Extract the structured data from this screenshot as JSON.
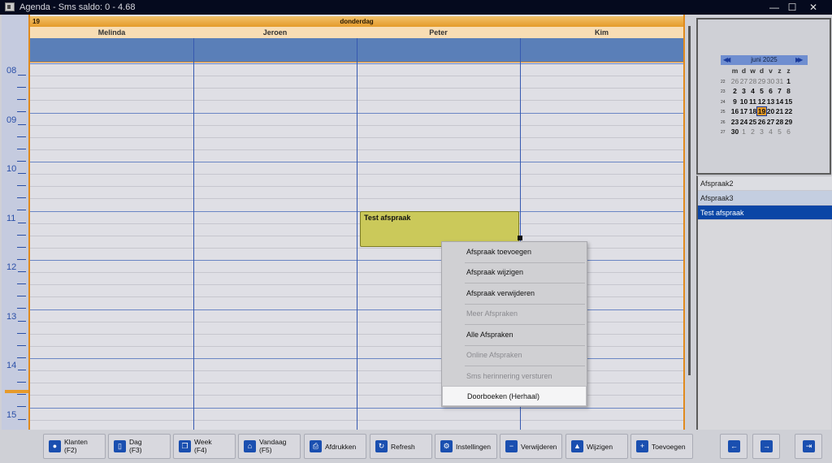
{
  "window": {
    "title": "Agenda - Sms saldo: 0 - 4.68",
    "minimize": "—",
    "maximize": "☐",
    "close": "✕"
  },
  "day": {
    "number": "19",
    "name": "donderdag"
  },
  "columns": [
    "Melinda",
    "Jeroen",
    "Peter",
    "Kim"
  ],
  "hours": [
    "08",
    "09",
    "10",
    "11",
    "12",
    "13",
    "14",
    "15"
  ],
  "appointment": {
    "title": "Test afspraak"
  },
  "context_menu": [
    {
      "label": "Afspraak toevoegen",
      "enabled": true
    },
    {
      "label": "Afspraak wijzigen",
      "enabled": true
    },
    {
      "label": "Afspraak verwijderen",
      "enabled": true
    },
    {
      "label": "Meer Afspraken",
      "enabled": false
    },
    {
      "label": "Alle Afspraken",
      "enabled": true
    },
    {
      "label": "Online Afspraken",
      "enabled": false
    },
    {
      "label": "Sms herinnering versturen",
      "enabled": false
    },
    {
      "label": "Doorboeken (Herhaal)",
      "enabled": true,
      "highlighted": true
    }
  ],
  "minicalendar": {
    "title": "juni 2025",
    "prev": "◀◀",
    "next": "▶▶",
    "weekdays": [
      "m",
      "d",
      "w",
      "d",
      "v",
      "z",
      "z"
    ],
    "weeks": [
      {
        "wk": "22",
        "days": [
          "26",
          "27",
          "28",
          "29",
          "30",
          "31",
          "1"
        ]
      },
      {
        "wk": "23",
        "days": [
          "2",
          "3",
          "4",
          "5",
          "6",
          "7",
          "8"
        ]
      },
      {
        "wk": "24",
        "days": [
          "9",
          "10",
          "11",
          "12",
          "13",
          "14",
          "15"
        ]
      },
      {
        "wk": "25",
        "days": [
          "16",
          "17",
          "18",
          "19",
          "20",
          "21",
          "22"
        ]
      },
      {
        "wk": "26",
        "days": [
          "23",
          "24",
          "25",
          "26",
          "27",
          "28",
          "29"
        ]
      },
      {
        "wk": "27",
        "days": [
          "30",
          "1",
          "2",
          "3",
          "4",
          "5",
          "6"
        ]
      }
    ],
    "today": "19"
  },
  "appointment_list": [
    "Afspraak2",
    "Afspraak3",
    "Test afspraak"
  ],
  "toolbar": {
    "klanten": {
      "line1": "Klanten",
      "line2": "(F2)"
    },
    "dag": {
      "line1": "Dag",
      "line2": "(F3)"
    },
    "week": {
      "line1": "Week",
      "line2": "(F4)"
    },
    "vandaag": {
      "line1": "Vandaag",
      "line2": "(F5)"
    },
    "afdrukken": "Afdrukken",
    "refresh": "Refresh",
    "instellingen": "Instellingen",
    "verwijderen": "Verwijderen",
    "wijzigen": "Wijzigen",
    "toevoegen": "Toevoegen"
  },
  "colors": {
    "accent": "#e08a1e",
    "selection": "#0a46a6",
    "appointment": "#cbc95a",
    "grid_line": "#3659b0"
  }
}
